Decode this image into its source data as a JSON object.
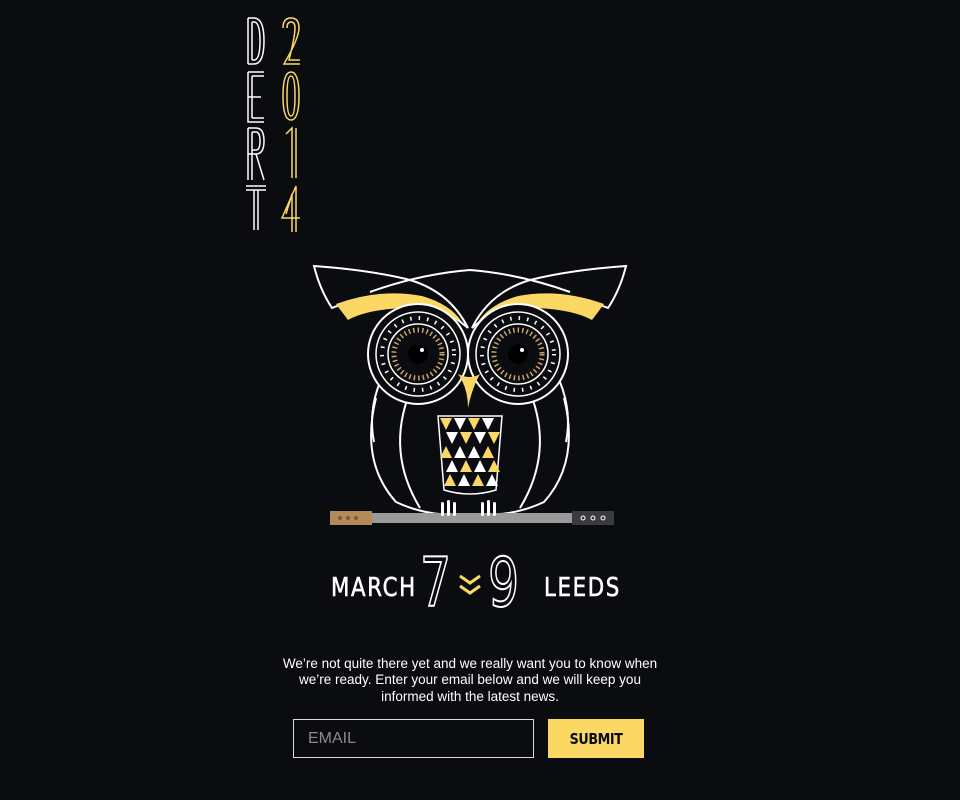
{
  "brand": {
    "name_letters": [
      "D",
      "E",
      "R",
      "T"
    ],
    "year_digits": [
      "2",
      "0",
      "1",
      "4"
    ]
  },
  "colors": {
    "background": "#0b0c10",
    "accent": "#fbd864",
    "text": "#ffffff"
  },
  "event": {
    "month": "MARCH",
    "start_day": "7",
    "end_day": "9",
    "city": "LEEDS"
  },
  "message": "We’re not quite there yet and we really want you to know when we’re ready.  Enter your email below and we will keep you informed with the latest news.",
  "form": {
    "email_placeholder": "EMAIL",
    "submit_label": "SUBMIT"
  },
  "icons": {
    "illustration": "owl-on-guitar-neck-illustration",
    "date_separator": "double-chevron-icon"
  }
}
